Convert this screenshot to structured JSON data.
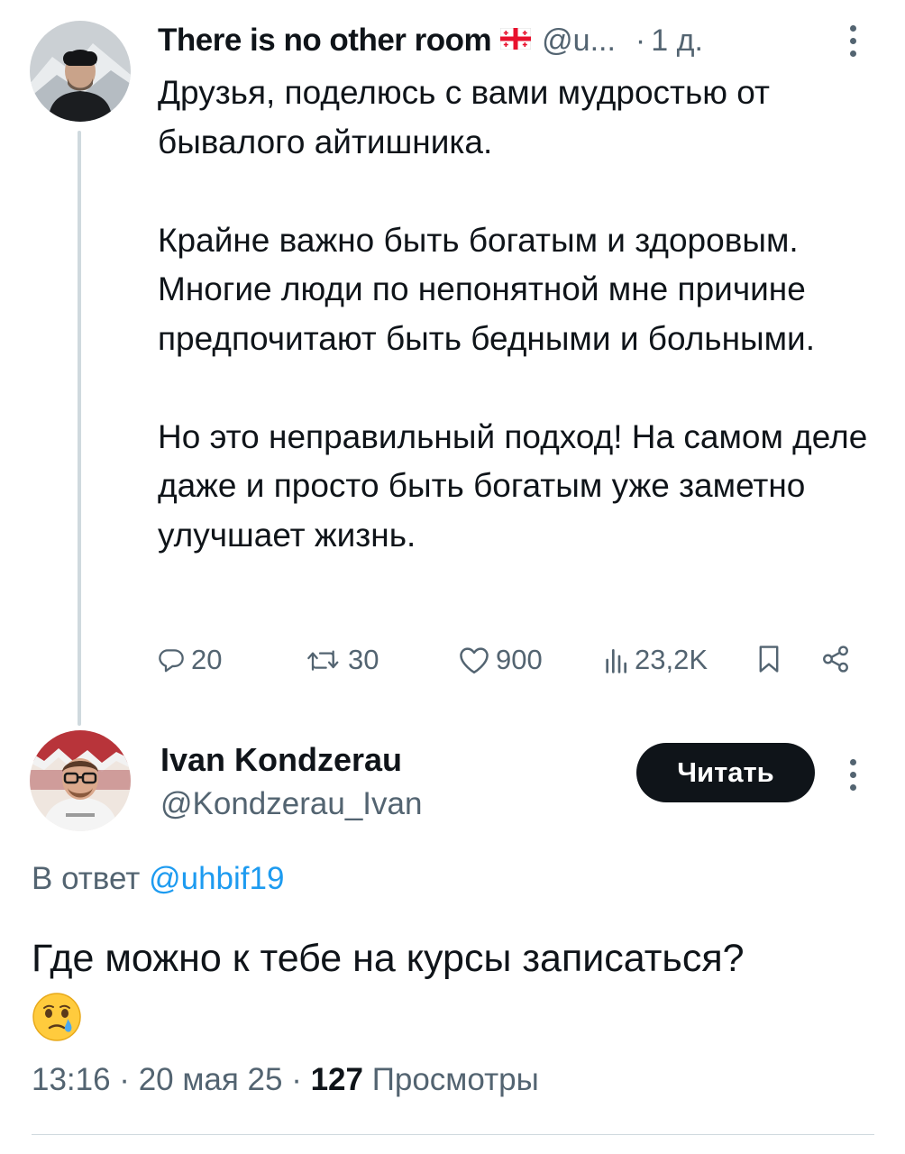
{
  "parent_tweet": {
    "author_name": "There is no other room",
    "author_handle": "@u...",
    "separator": "·",
    "time_ago": "1 д.",
    "paragraphs": [
      "Друзья, поделюсь с вами мудростью от бывалого айтишника.",
      "Крайне важно быть богатым и здоровым. Многие люди по непонятной мне причине предпочитают быть бедными и больными.",
      "Но это неправильный подход! На самом деле даже и просто быть богатым уже заметно улучшает жизнь."
    ],
    "actions": {
      "replies": "20",
      "retweets": "30",
      "likes": "900",
      "views": "23,2K"
    }
  },
  "reply_tweet": {
    "author_name": "Ivan Kondzerau",
    "author_handle": "@Kondzerau_Ivan",
    "follow_label": "Читать",
    "reply_prefix": "В ответ",
    "reply_mention": "@uhbif19",
    "text": "Где можно к тебе на курсы записаться?",
    "time": "13:16 · 20 мая 25 · ",
    "views_count": "127",
    "views_label": " Просмотры"
  },
  "icons": [
    "georgia-flag",
    "more-vertical",
    "reply",
    "retweet",
    "like",
    "views",
    "bookmark",
    "share",
    "face-holding-back-tears-emoji"
  ],
  "colors": {
    "text": "#0f1419",
    "secondary": "#536471",
    "link": "#1d9bf0",
    "line": "#cfd9de",
    "button": "#0f1419"
  }
}
